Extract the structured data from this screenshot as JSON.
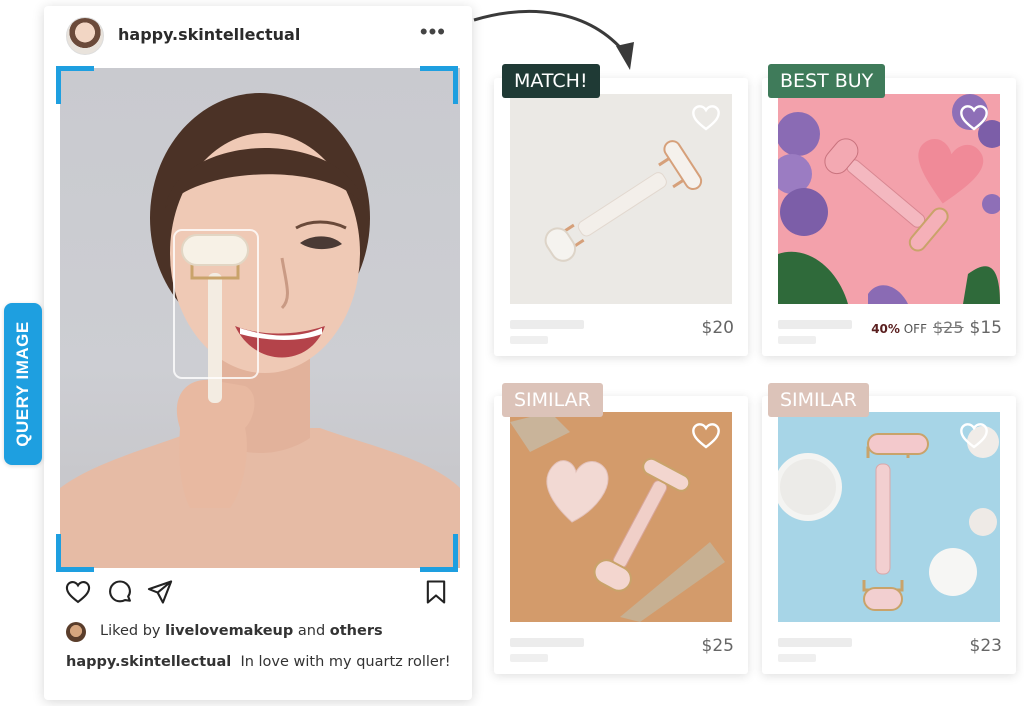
{
  "post": {
    "username": "happy.skintellectual",
    "more_icon": "•••",
    "liked": {
      "prefix": "Liked by ",
      "user": "livelovemakeup",
      "middle": " and ",
      "others": "others"
    },
    "caption": {
      "user": "happy.skintellectual",
      "text": "In love with my quartz roller!"
    }
  },
  "query_tab": {
    "label": "QUERY IMAGE",
    "color": "#1e9fe0"
  },
  "products": [
    {
      "badge": "MATCH!",
      "badge_bg": "#1f3a35",
      "badge_color": "#ffffff",
      "price": "$20"
    },
    {
      "badge": "BEST BUY",
      "badge_bg": "#3f7b5a",
      "badge_color": "#ffffff",
      "discount_pct": "40%",
      "discount_word": " OFF",
      "old_price": "$25",
      "price": "$15"
    },
    {
      "badge": "SIMILAR",
      "badge_bg": "#dcc3b9",
      "badge_color": "#ffffff",
      "price": "$25"
    },
    {
      "badge": "SIMILAR",
      "badge_bg": "#dcc3b9",
      "badge_color": "#ffffff",
      "price": "$23"
    }
  ]
}
